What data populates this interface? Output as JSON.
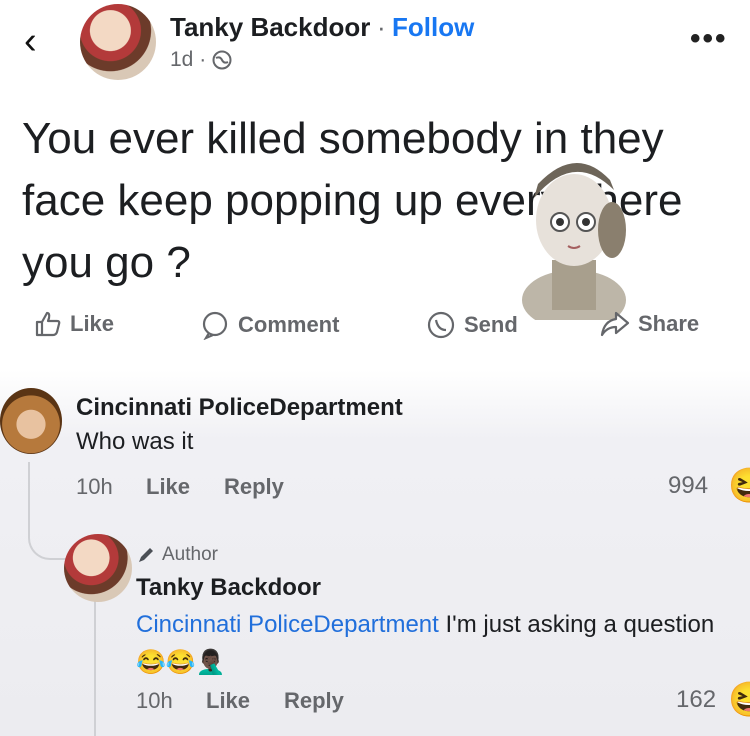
{
  "header": {
    "back_icon": "chevron-left-icon",
    "author": "Tanky Backdoor",
    "separator": "·",
    "follow": "Follow",
    "time": "1d ·",
    "privacy_icon": "globe-icon",
    "more": "•••"
  },
  "post": {
    "text": "You ever killed somebody in they face keep popping up everywhere you go ?"
  },
  "actions": {
    "like": "Like",
    "comment": "Comment",
    "send": "Send",
    "share": "Share"
  },
  "comments": [
    {
      "author": "Cincinnati PoliceDepartment",
      "text": "Who was it",
      "time": "10h",
      "like": "Like",
      "reply": "Reply",
      "reaction_count": "994",
      "reaction_emoji": "😆"
    },
    {
      "badge": "Author",
      "author": "Tanky Backdoor",
      "mention": "Cincinnati PoliceDepartment",
      "text": " I'm just asking a question",
      "emojis": "😂😂🤦🏿‍♂️",
      "time": "10h",
      "like": "Like",
      "reply": "Reply",
      "reaction_count": "162",
      "reaction_emoji": "😆"
    }
  ],
  "colors": {
    "accent": "#1877f2",
    "mention": "#216fdb",
    "secondary_text": "#65676b"
  }
}
